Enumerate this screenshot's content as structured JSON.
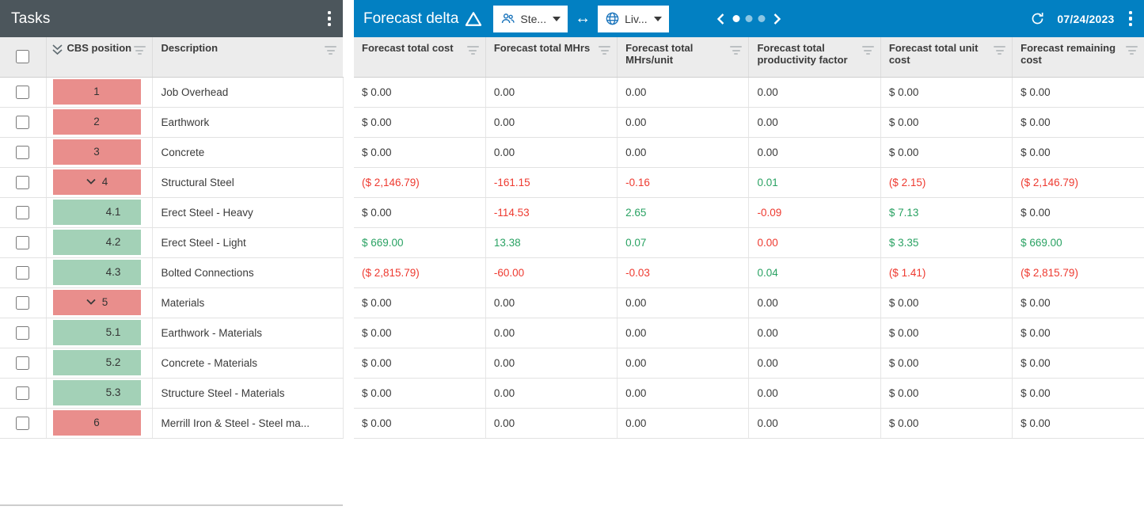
{
  "theme": {
    "header_dark": "#4c565c",
    "header_blue": "#0280c2",
    "badge_red": "#e98e8c",
    "badge_green": "#a3d1b7",
    "text_red": "#ee3a30",
    "text_green": "#2aa263",
    "icon_blue": "#1c75bc"
  },
  "left_panel": {
    "title": "Tasks",
    "header": {
      "cbs_label": "CBS position",
      "desc_label": "Description"
    },
    "rows": [
      {
        "pos": "1",
        "color": "red",
        "chevron": false,
        "child": false,
        "desc": "Job Overhead"
      },
      {
        "pos": "2",
        "color": "red",
        "chevron": false,
        "child": false,
        "desc": "Earthwork"
      },
      {
        "pos": "3",
        "color": "red",
        "chevron": false,
        "child": false,
        "desc": "Concrete"
      },
      {
        "pos": "4",
        "color": "red",
        "chevron": true,
        "child": false,
        "desc": "Structural Steel"
      },
      {
        "pos": "4.1",
        "color": "green",
        "chevron": false,
        "child": true,
        "desc": "Erect Steel - Heavy"
      },
      {
        "pos": "4.2",
        "color": "green",
        "chevron": false,
        "child": true,
        "desc": "Erect Steel - Light"
      },
      {
        "pos": "4.3",
        "color": "green",
        "chevron": false,
        "child": true,
        "desc": "Bolted Connections"
      },
      {
        "pos": "5",
        "color": "red",
        "chevron": true,
        "child": false,
        "desc": "Materials"
      },
      {
        "pos": "5.1",
        "color": "green",
        "chevron": false,
        "child": true,
        "desc": "Earthwork - Materials"
      },
      {
        "pos": "5.2",
        "color": "green",
        "chevron": false,
        "child": true,
        "desc": "Concrete - Materials"
      },
      {
        "pos": "5.3",
        "color": "green",
        "chevron": false,
        "child": true,
        "desc": "Structure Steel - Materials"
      },
      {
        "pos": "6",
        "color": "red",
        "chevron": false,
        "child": false,
        "desc": "Merrill Iron & Steel - Steel ma..."
      }
    ]
  },
  "right_panel": {
    "title": "Forecast delta",
    "baseline_dropdown": {
      "label": "Ste..."
    },
    "compare_dropdown": {
      "label": "Liv..."
    },
    "pager": {
      "dots": 3,
      "active_dot": 0
    },
    "date": "07/24/2023",
    "columns": [
      "Forecast total cost",
      "Forecast total MHrs",
      "Forecast total MHrs/unit",
      "Forecast total productivity factor",
      "Forecast total unit cost",
      "Forecast remaining cost"
    ],
    "rows": [
      [
        {
          "v": "$ 0.00",
          "c": "dark"
        },
        {
          "v": "0.00",
          "c": "dark"
        },
        {
          "v": "0.00",
          "c": "dark"
        },
        {
          "v": "0.00",
          "c": "dark"
        },
        {
          "v": "$ 0.00",
          "c": "dark"
        },
        {
          "v": "$ 0.00",
          "c": "dark"
        }
      ],
      [
        {
          "v": "$ 0.00",
          "c": "dark"
        },
        {
          "v": "0.00",
          "c": "dark"
        },
        {
          "v": "0.00",
          "c": "dark"
        },
        {
          "v": "0.00",
          "c": "dark"
        },
        {
          "v": "$ 0.00",
          "c": "dark"
        },
        {
          "v": "$ 0.00",
          "c": "dark"
        }
      ],
      [
        {
          "v": "$ 0.00",
          "c": "dark"
        },
        {
          "v": "0.00",
          "c": "dark"
        },
        {
          "v": "0.00",
          "c": "dark"
        },
        {
          "v": "0.00",
          "c": "dark"
        },
        {
          "v": "$ 0.00",
          "c": "dark"
        },
        {
          "v": "$ 0.00",
          "c": "dark"
        }
      ],
      [
        {
          "v": "($ 2,146.79)",
          "c": "red"
        },
        {
          "v": "-161.15",
          "c": "red"
        },
        {
          "v": "-0.16",
          "c": "red"
        },
        {
          "v": "0.01",
          "c": "green"
        },
        {
          "v": "($ 2.15)",
          "c": "red"
        },
        {
          "v": "($ 2,146.79)",
          "c": "red"
        }
      ],
      [
        {
          "v": "$ 0.00",
          "c": "dark"
        },
        {
          "v": "-114.53",
          "c": "red"
        },
        {
          "v": "2.65",
          "c": "green"
        },
        {
          "v": "-0.09",
          "c": "red"
        },
        {
          "v": "$ 7.13",
          "c": "green"
        },
        {
          "v": "$ 0.00",
          "c": "dark"
        }
      ],
      [
        {
          "v": "$ 669.00",
          "c": "green"
        },
        {
          "v": "13.38",
          "c": "green"
        },
        {
          "v": "0.07",
          "c": "green"
        },
        {
          "v": "0.00",
          "c": "red"
        },
        {
          "v": "$ 3.35",
          "c": "green"
        },
        {
          "v": "$ 669.00",
          "c": "green"
        }
      ],
      [
        {
          "v": "($ 2,815.79)",
          "c": "red"
        },
        {
          "v": "-60.00",
          "c": "red"
        },
        {
          "v": "-0.03",
          "c": "red"
        },
        {
          "v": "0.04",
          "c": "green"
        },
        {
          "v": "($ 1.41)",
          "c": "red"
        },
        {
          "v": "($ 2,815.79)",
          "c": "red"
        }
      ],
      [
        {
          "v": "$ 0.00",
          "c": "dark"
        },
        {
          "v": "0.00",
          "c": "dark"
        },
        {
          "v": "0.00",
          "c": "dark"
        },
        {
          "v": "0.00",
          "c": "dark"
        },
        {
          "v": "$ 0.00",
          "c": "dark"
        },
        {
          "v": "$ 0.00",
          "c": "dark"
        }
      ],
      [
        {
          "v": "$ 0.00",
          "c": "dark"
        },
        {
          "v": "0.00",
          "c": "dark"
        },
        {
          "v": "0.00",
          "c": "dark"
        },
        {
          "v": "0.00",
          "c": "dark"
        },
        {
          "v": "$ 0.00",
          "c": "dark"
        },
        {
          "v": "$ 0.00",
          "c": "dark"
        }
      ],
      [
        {
          "v": "$ 0.00",
          "c": "dark"
        },
        {
          "v": "0.00",
          "c": "dark"
        },
        {
          "v": "0.00",
          "c": "dark"
        },
        {
          "v": "0.00",
          "c": "dark"
        },
        {
          "v": "$ 0.00",
          "c": "dark"
        },
        {
          "v": "$ 0.00",
          "c": "dark"
        }
      ],
      [
        {
          "v": "$ 0.00",
          "c": "dark"
        },
        {
          "v": "0.00",
          "c": "dark"
        },
        {
          "v": "0.00",
          "c": "dark"
        },
        {
          "v": "0.00",
          "c": "dark"
        },
        {
          "v": "$ 0.00",
          "c": "dark"
        },
        {
          "v": "$ 0.00",
          "c": "dark"
        }
      ],
      [
        {
          "v": "$ 0.00",
          "c": "dark"
        },
        {
          "v": "0.00",
          "c": "dark"
        },
        {
          "v": "0.00",
          "c": "dark"
        },
        {
          "v": "0.00",
          "c": "dark"
        },
        {
          "v": "$ 0.00",
          "c": "dark"
        },
        {
          "v": "$ 0.00",
          "c": "dark"
        }
      ]
    ]
  }
}
